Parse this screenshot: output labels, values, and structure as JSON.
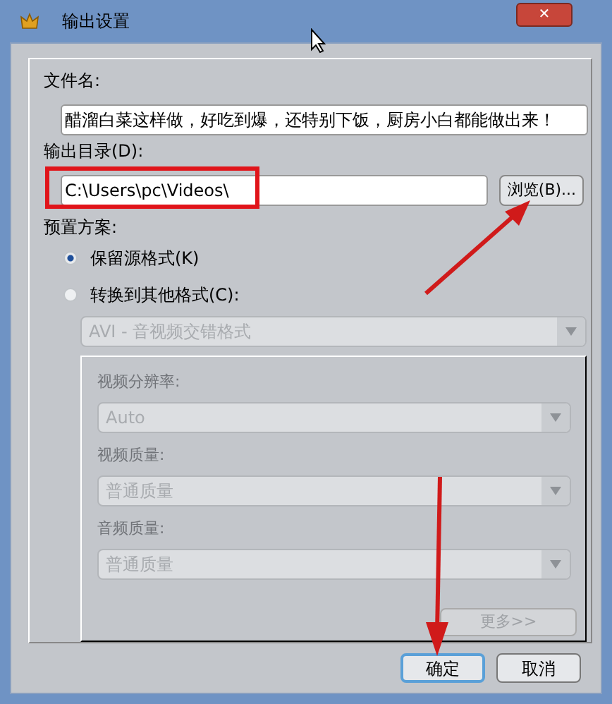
{
  "window": {
    "title": "输出设置",
    "close": "✕"
  },
  "file_name": {
    "label": "文件名:",
    "value": "醋溜白菜这样做，好吃到爆，还特别下饭，厨房小白都能做出来！"
  },
  "output_dir": {
    "label": "输出目录(D):",
    "value": "C:\\Users\\pc\\Videos\\",
    "browse": "浏览(B)..."
  },
  "preset": {
    "label": "预置方案:",
    "options": [
      {
        "label": "保留源格式(K)",
        "selected": true
      },
      {
        "label": "转换到其他格式(C):",
        "selected": false
      }
    ]
  },
  "format": {
    "value": "AVI - 音视频交错格式",
    "disabled": true
  },
  "settings": [
    {
      "label": "视频分辨率:",
      "value": "Auto",
      "disabled": true
    },
    {
      "label": "视频质量:",
      "value": "普通质量",
      "disabled": true
    },
    {
      "label": "音频质量:",
      "value": "普通质量",
      "disabled": true
    }
  ],
  "more_button": {
    "label": "更多>>",
    "disabled": true
  },
  "buttons": [
    {
      "label": "确定",
      "default": true
    },
    {
      "label": "取消",
      "default": false
    }
  ]
}
